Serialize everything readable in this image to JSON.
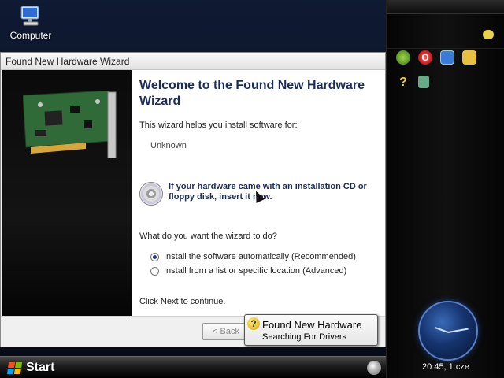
{
  "desktop": {
    "icons": [
      {
        "label": "Computer",
        "icon": "computer-icon"
      }
    ]
  },
  "wizard": {
    "title": "Found New Hardware Wizard",
    "heading": "Welcome to the Found New Hardware Wizard",
    "intro": "This wizard helps you install software for:",
    "device": "Unknown",
    "cd_prompt": "If your hardware came with an installation CD or floppy disk, insert it now.",
    "question": "What do you want the wizard to do?",
    "options": [
      {
        "label": "Install the software automatically (Recommended)",
        "checked": true
      },
      {
        "label": "Install from a list or specific location (Advanced)",
        "checked": false
      }
    ],
    "continue_text": "Click Next to continue.",
    "back_label": "< Back"
  },
  "balloon": {
    "title": "Found New Hardware",
    "subtitle": "Searching For Drivers"
  },
  "taskbar": {
    "start_label": "Start"
  },
  "sidebar": {
    "clock_text": "20:45, 1 cze",
    "icons": [
      "chat-icon",
      "globe-icon",
      "opera-icon",
      "monitor-icon",
      "folder-icon",
      "help-icon",
      "device-icon"
    ]
  },
  "colors": {
    "heading": "#1a2c5a",
    "accent": "#2a3f7a"
  }
}
